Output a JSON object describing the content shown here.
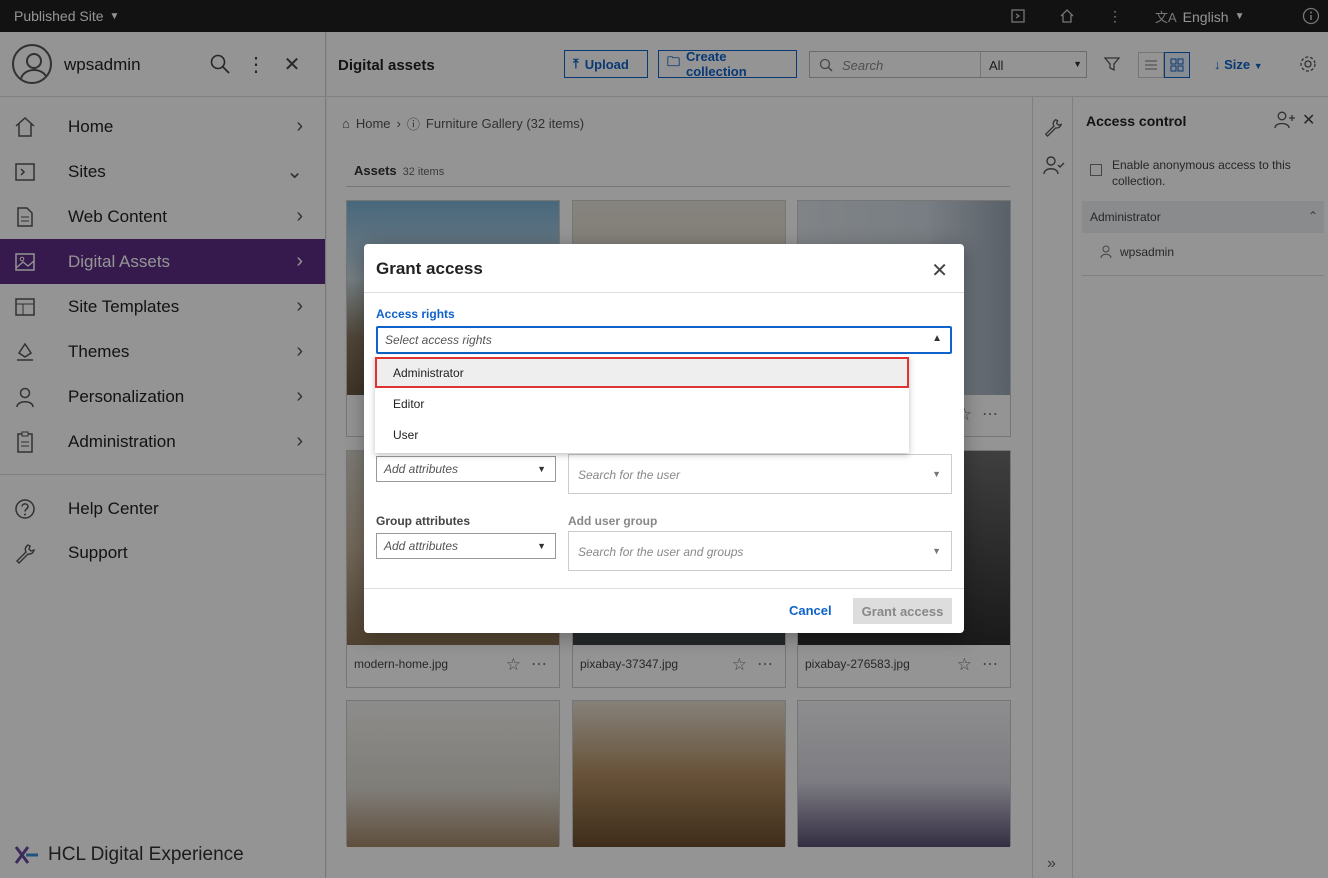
{
  "topbar": {
    "site_label": "Published Site",
    "language": "English"
  },
  "sidebar": {
    "username": "wpsadmin",
    "items": [
      {
        "label": "Home",
        "icon": "home-icon"
      },
      {
        "label": "Sites",
        "icon": "sites-icon"
      },
      {
        "label": "Web Content",
        "icon": "document-icon"
      },
      {
        "label": "Digital Assets",
        "icon": "image-icon"
      },
      {
        "label": "Site Templates",
        "icon": "template-icon"
      },
      {
        "label": "Themes",
        "icon": "themes-icon"
      },
      {
        "label": "Personalization",
        "icon": "person-icon"
      },
      {
        "label": "Administration",
        "icon": "clipboard-icon"
      }
    ],
    "bottom_items": [
      {
        "label": "Help Center",
        "icon": "help-icon"
      },
      {
        "label": "Support",
        "icon": "wrench-icon"
      }
    ],
    "brand": "HCL Digital Experience",
    "active_color": "#5e2e86"
  },
  "main": {
    "title": "Digital assets",
    "upload_label": "Upload",
    "create_collection_label": "Create collection",
    "search_placeholder": "Search",
    "search_scope": "All",
    "size_label": "Size",
    "breadcrumb": {
      "home": "Home",
      "collection": "Furniture Gallery (32 items)"
    },
    "assets_heading": "Assets",
    "assets_count": "32 items",
    "cards": [
      {
        "caption": ""
      },
      {
        "caption": ""
      },
      {
        "caption": ""
      },
      {
        "caption": "modern-home.jpg"
      },
      {
        "caption": "pixabay-37347.jpg"
      },
      {
        "caption": "pixabay-276583.jpg"
      },
      {
        "caption": ""
      },
      {
        "caption": ""
      },
      {
        "caption": ""
      }
    ]
  },
  "panel": {
    "title": "Access control",
    "anonymous_label": "Enable anonymous access to this collection.",
    "group": "Administrator",
    "member": "wpsadmin"
  },
  "modal": {
    "title": "Grant access",
    "access_rights_label": "Access rights",
    "access_rights_placeholder": "Select access rights",
    "options": [
      "Administrator",
      "Editor",
      "User"
    ],
    "user_attr_placeholder": "Add attributes",
    "user_search_placeholder": "Search for the user",
    "group_attr_label": "Group attributes",
    "group_attr_placeholder": "Add attributes",
    "add_group_label": "Add user group",
    "group_search_placeholder": "Search for the user and groups",
    "cancel_label": "Cancel",
    "grant_label": "Grant access"
  }
}
